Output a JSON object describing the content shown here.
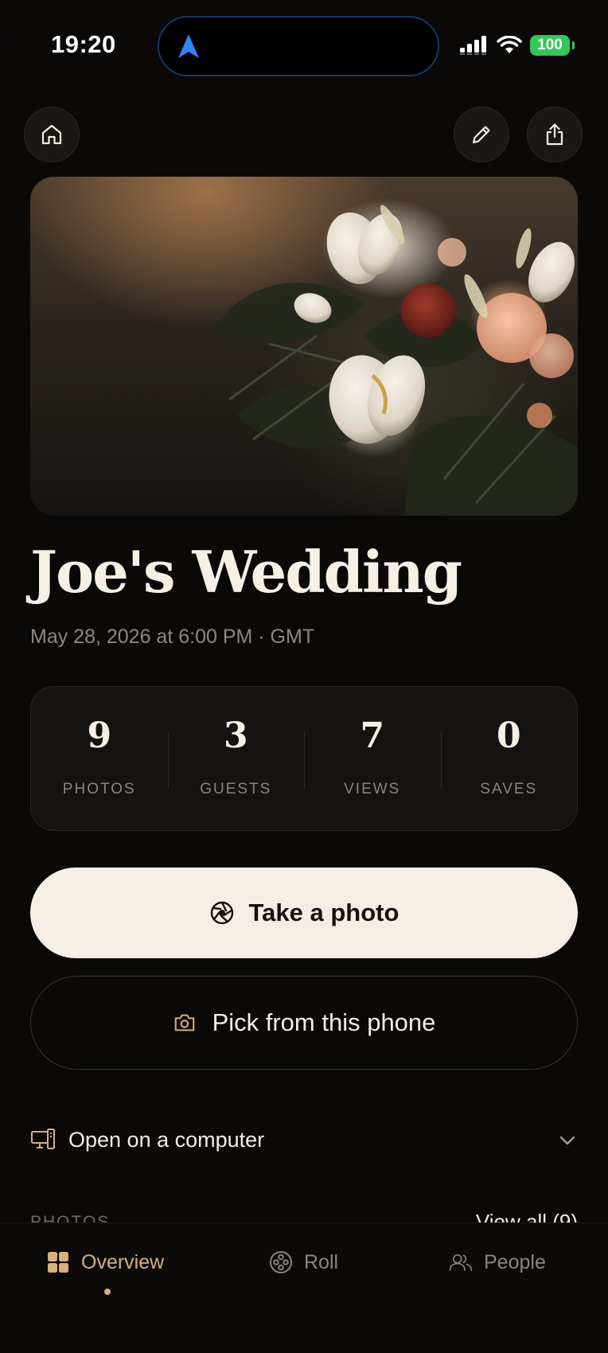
{
  "status_bar": {
    "time": "19:20",
    "battery": "100",
    "icons": [
      "location-arrow-icon",
      "cellular-signal-icon",
      "wifi-icon",
      "battery-icon"
    ]
  },
  "toolbar": {
    "icons": [
      "home-icon",
      "pencil-icon",
      "share-icon"
    ]
  },
  "hero": {
    "image": "bridal-bouquet-photo"
  },
  "event": {
    "title": "Joe's Wedding",
    "date": "May 28, 2026 at 6:00 PM · GMT"
  },
  "stats": [
    {
      "value": "9",
      "label": "PHOTOS"
    },
    {
      "value": "3",
      "label": "GUESTS"
    },
    {
      "value": "7",
      "label": "VIEWS"
    },
    {
      "value": "0",
      "label": "SAVES"
    }
  ],
  "actions": {
    "take_photo": "Take a photo",
    "pick_from_phone": "Pick from this phone"
  },
  "open_on_computer": {
    "label": "Open on a computer"
  },
  "photos_section": {
    "label": "PHOTOS",
    "view_all": "View all (9)"
  },
  "tabs": [
    {
      "label": "Overview",
      "icon": "grid-icon",
      "active": true
    },
    {
      "label": "Roll",
      "icon": "film-reel-icon",
      "active": false
    },
    {
      "label": "People",
      "icon": "people-icon",
      "active": false
    }
  ],
  "colors": {
    "background": "#0a0908",
    "accent": "#d7b07a",
    "primary_button": "#f4eee4",
    "battery": "#33c759",
    "island_outline": "#143766"
  }
}
